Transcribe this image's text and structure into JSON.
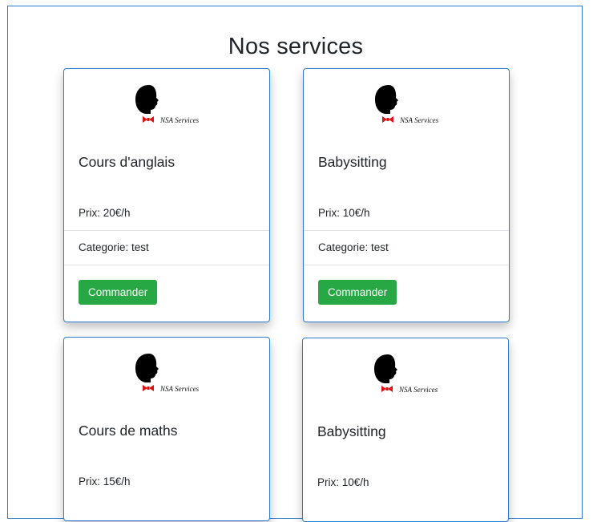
{
  "page": {
    "title": "Nos services"
  },
  "brand": {
    "logo_text": "NSA Services"
  },
  "services": [
    {
      "name": "Cours d'anglais",
      "price": "Prix: 20€/h",
      "category": "Categorie: test",
      "button": "Commander"
    },
    {
      "name": "Babysitting",
      "price": "Prix: 10€/h",
      "category": "Categorie: test",
      "button": "Commander"
    },
    {
      "name": "Cours de maths",
      "price": "Prix: 15€/h",
      "category": "",
      "button": ""
    },
    {
      "name": "Babysitting",
      "price": "Prix: 10€/h",
      "category": "",
      "button": ""
    }
  ],
  "colors": {
    "accent_border": "#2b7cd3",
    "button_green": "#28a745"
  }
}
